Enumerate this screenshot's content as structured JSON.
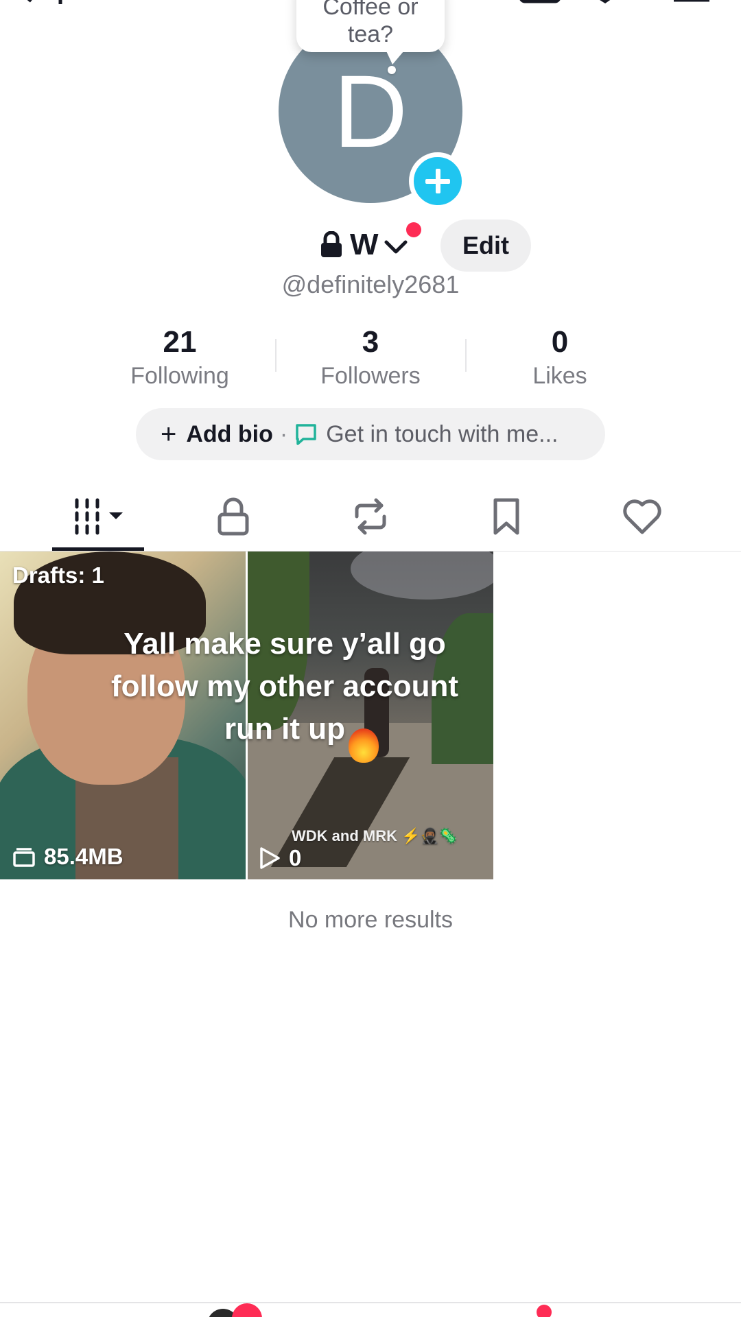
{
  "bubble": {
    "line1": "Coffee or",
    "line2": "tea?"
  },
  "avatar": {
    "initial": "D"
  },
  "profile": {
    "username": "W",
    "handle": "@definitely2681",
    "edit_label": "Edit"
  },
  "stats": [
    {
      "value": "21",
      "label": "Following"
    },
    {
      "value": "3",
      "label": "Followers"
    },
    {
      "value": "0",
      "label": "Likes"
    }
  ],
  "bio": {
    "plus": "+",
    "add_label": "Add bio",
    "separator": "·",
    "touch_label": "Get in touch with me..."
  },
  "grid": {
    "draft": {
      "label": "Drafts: 1",
      "size": "85.4MB"
    },
    "video": {
      "caption_small": "WDK  and MRK ⚡🥷🏾🦠",
      "plays": "0"
    },
    "overlay_text": [
      "Yall make sure y’all go",
      "follow my other account",
      "run it up"
    ]
  },
  "footer": {
    "no_more": "No more results"
  },
  "colors": {
    "accent_red": "#fe2c55",
    "plus_blue": "#20c5f0",
    "avatar_bg": "#7a8f9c"
  },
  "icons": [
    "add-user-icon",
    "inbox-icon",
    "edit-icon",
    "menu-icon",
    "lock-icon",
    "chevron-down-icon",
    "chat-bubble-icon",
    "grid-icon",
    "private-lock-icon",
    "repost-icon",
    "bookmark-icon",
    "heart-icon",
    "drafts-icon",
    "play-icon"
  ]
}
